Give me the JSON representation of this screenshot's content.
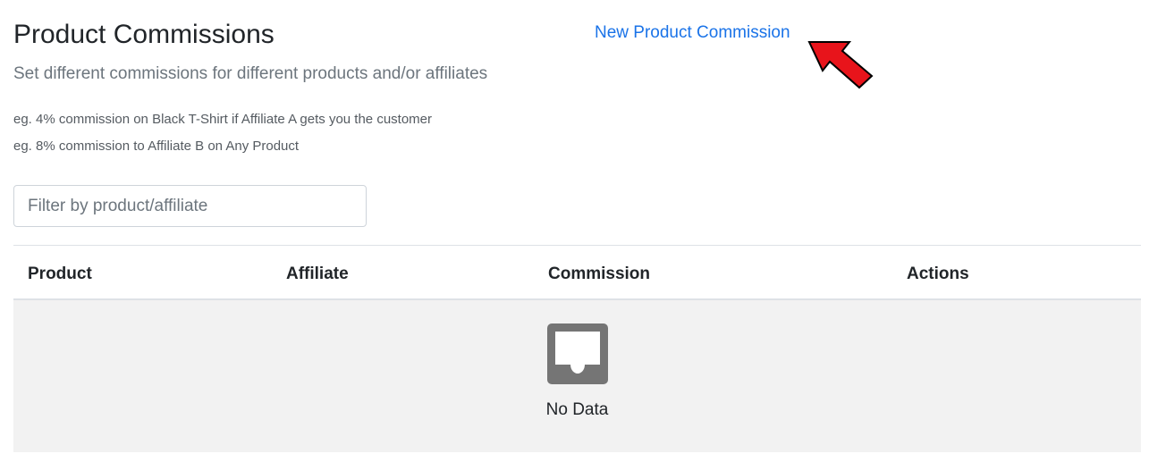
{
  "header": {
    "title": "Product Commissions",
    "subtitle": "Set different commissions for different products and/or affiliates",
    "examples": [
      "eg. 4% commission on Black T-Shirt if Affiliate A gets you the customer",
      "eg. 8% commission to Affiliate B on Any Product"
    ],
    "new_link": "New Product Commission"
  },
  "filter": {
    "placeholder": "Filter by product/affiliate",
    "value": ""
  },
  "table": {
    "columns": [
      "Product",
      "Affiliate",
      "Commission",
      "Actions"
    ],
    "rows": [],
    "empty_text": "No Data"
  },
  "icons": {
    "empty": "inbox-icon",
    "annotation": "red-arrow-icon"
  },
  "colors": {
    "link": "#1a73e8",
    "annotation_arrow": "#e8141b",
    "empty_bg": "#f2f2f2",
    "empty_icon": "#757575"
  }
}
